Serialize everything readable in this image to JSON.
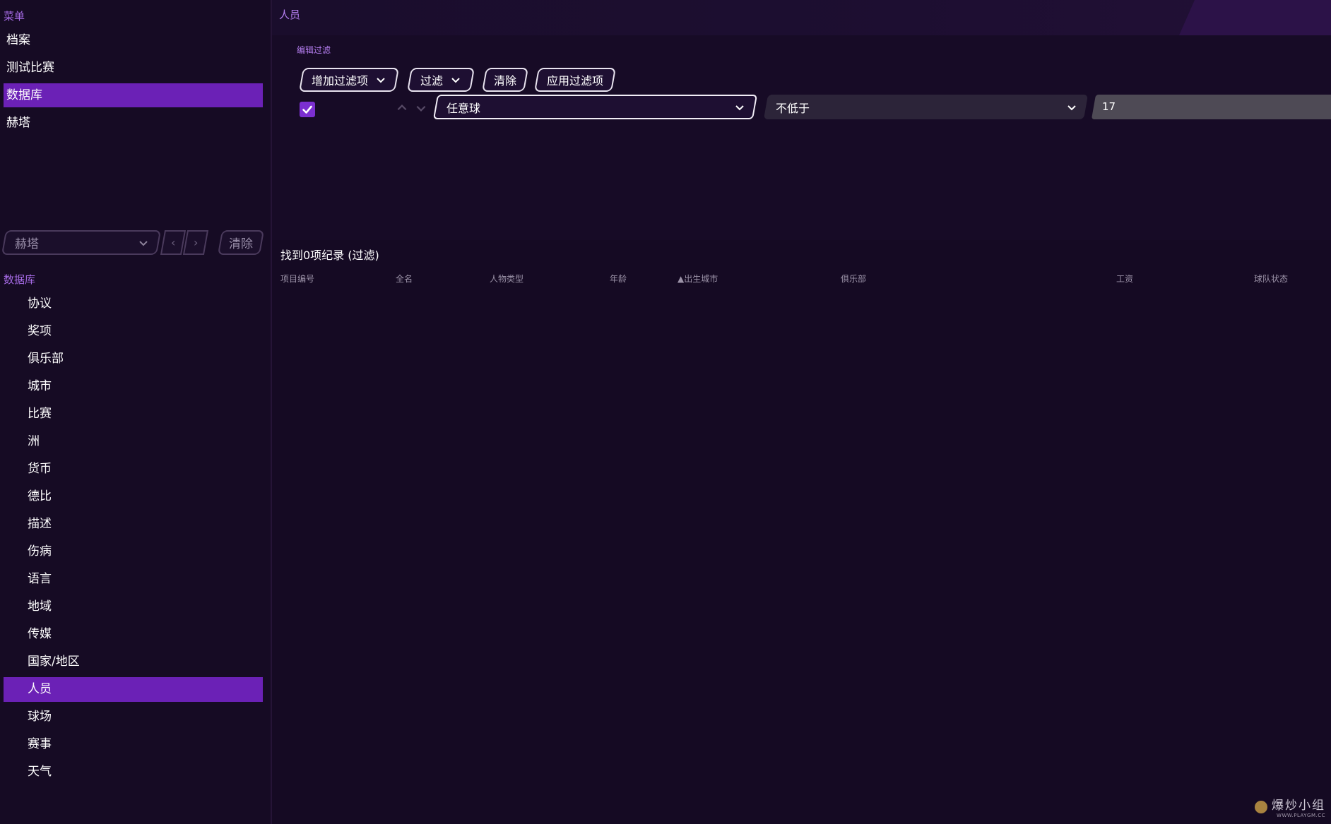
{
  "sidebar": {
    "menu_label": "菜单",
    "menu_items": [
      {
        "label": "档案",
        "active": false
      },
      {
        "label": "测试比赛",
        "active": false
      },
      {
        "label": "数据库",
        "active": true
      },
      {
        "label": "赫塔",
        "active": false
      }
    ],
    "club_select": {
      "value": "赫塔"
    },
    "clear_label": "清除",
    "database_label": "数据库",
    "database_items": [
      {
        "label": "协议",
        "active": false
      },
      {
        "label": "奖项",
        "active": false
      },
      {
        "label": "俱乐部",
        "active": false
      },
      {
        "label": "城市",
        "active": false
      },
      {
        "label": "比赛",
        "active": false
      },
      {
        "label": "洲",
        "active": false
      },
      {
        "label": "货币",
        "active": false
      },
      {
        "label": "德比",
        "active": false
      },
      {
        "label": "描述",
        "active": false
      },
      {
        "label": "伤病",
        "active": false
      },
      {
        "label": "语言",
        "active": false
      },
      {
        "label": "地域",
        "active": false
      },
      {
        "label": "传媒",
        "active": false
      },
      {
        "label": "国家/地区",
        "active": false
      },
      {
        "label": "人员",
        "active": true
      },
      {
        "label": "球场",
        "active": false
      },
      {
        "label": "赛事",
        "active": false
      },
      {
        "label": "天气",
        "active": false
      }
    ]
  },
  "main": {
    "page_title": "人员",
    "filter": {
      "label": "编辑过滤",
      "add_filter_label": "增加过滤项",
      "filter_label": "过滤",
      "clear_label": "清除",
      "apply_label": "应用过滤项",
      "row": {
        "checked": true,
        "field": "任意球",
        "operator": "不低于",
        "value": "17"
      }
    },
    "results_text": "找到0项纪录 (过滤)",
    "columns": [
      {
        "label": "项目编号"
      },
      {
        "label": "全名"
      },
      {
        "label": "人物类型"
      },
      {
        "label": "年龄"
      },
      {
        "label": "▲出生城市"
      },
      {
        "label": "俱乐部"
      },
      {
        "label": "工资"
      },
      {
        "label": "球队状态"
      }
    ]
  },
  "watermark": {
    "cn": "爆炒小组",
    "en": "WWW.PLAYGM.CC"
  },
  "colors": {
    "accent": "#6b21b6",
    "background": "#150a23",
    "label": "#b57ef0"
  }
}
